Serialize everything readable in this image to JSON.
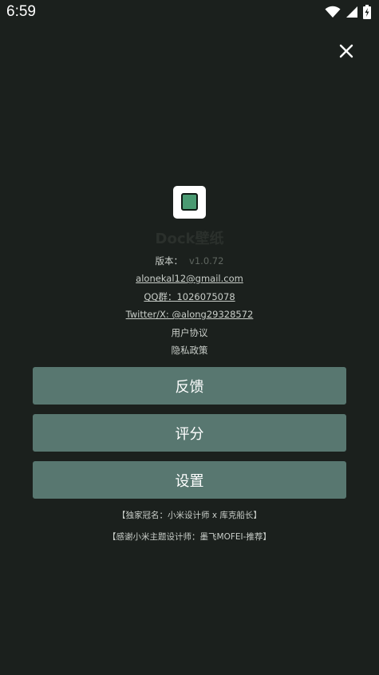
{
  "status_bar": {
    "time": "6:59",
    "icons": [
      "wifi-icon",
      "signal-icon",
      "battery-icon"
    ]
  },
  "header": {
    "close_icon": "close-icon"
  },
  "app": {
    "name": "Dock壁纸",
    "version_label": "版本：",
    "version_value": "v1.0.72",
    "email": "alonekal12@gmail.com",
    "qq_group": "QQ群：1026075078",
    "twitter": "Twitter/X: @along29328572",
    "user_agreement": "用户协议",
    "privacy_policy": "隐私政策"
  },
  "buttons": {
    "feedback": "反馈",
    "rate": "评分",
    "settings": "设置"
  },
  "credits": {
    "line1": "【独家冠名：小米设计师 x 库克船长】",
    "line2": "【感谢小米主题设计师：墨飞MOFEI-推荐】"
  },
  "colors": {
    "background": "#1b201d",
    "button": "#587770",
    "icon_green": "#4a9a72"
  }
}
